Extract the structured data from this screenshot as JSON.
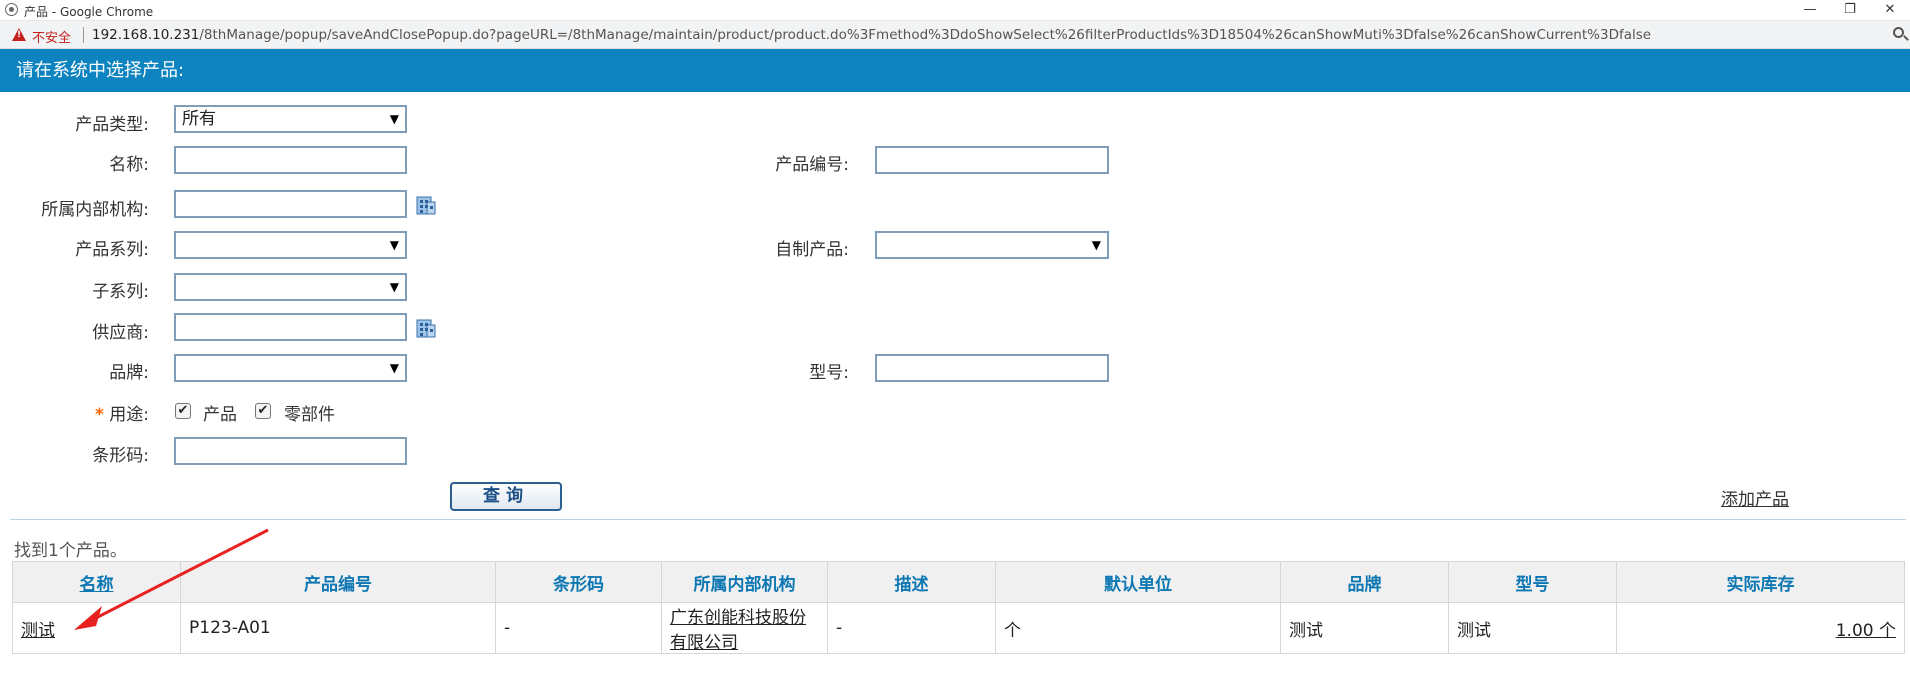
{
  "browser": {
    "window_title": "产品 - Google Chrome",
    "insecure_label": "不安全",
    "url_host": "192.168.10.231",
    "url_path": "/8thManage/popup/saveAndClosePopup.do?pageURL=/8thManage/maintain/product/product.do%3Fmethod%3DdoShowSelect%26filterProductIds%3D18504%26canShowMuti%3Dfalse%26canShowCurrent%3Dfalse"
  },
  "header": {
    "title": "请在系统中选择产品:"
  },
  "form": {
    "product_type": {
      "label": "产品类型:",
      "value": "所有"
    },
    "name": {
      "label": "名称:",
      "value": ""
    },
    "product_code": {
      "label": "产品编号:",
      "value": ""
    },
    "org": {
      "label": "所属内部机构:",
      "value": ""
    },
    "series": {
      "label": "产品系列:",
      "value": ""
    },
    "self_made": {
      "label": "自制产品:",
      "value": ""
    },
    "sub_series": {
      "label": "子系列:",
      "value": ""
    },
    "supplier": {
      "label": "供应商:",
      "value": ""
    },
    "brand": {
      "label": "品牌:",
      "value": ""
    },
    "model": {
      "label": "型号:",
      "value": ""
    },
    "usage": {
      "star": "*",
      "label": "用途:",
      "options": [
        {
          "label": "产品",
          "checked": true
        },
        {
          "label": "零部件",
          "checked": true
        }
      ]
    },
    "barcode": {
      "label": "条形码:",
      "value": ""
    },
    "query_button": "查询",
    "add_link": "添加产品"
  },
  "results": {
    "summary": "找到1个产品。",
    "columns": [
      "名称",
      "产品编号",
      "条形码",
      "所属内部机构",
      "描述",
      "默认单位",
      "品牌",
      "型号",
      "实际库存"
    ],
    "rows": [
      {
        "name": "测试",
        "code": "P123-A01",
        "barcode": "-",
        "org_line1": "广东创能科技股份",
        "org_line2": "有限公司",
        "desc": "-",
        "unit": "个",
        "brand": "测试",
        "model": "测试",
        "stock": "1.00 个"
      }
    ]
  },
  "colors": {
    "header_bg": "#0d84bf",
    "annotation_arrow": "#e82121",
    "column_header_text": "#0d77b3"
  }
}
